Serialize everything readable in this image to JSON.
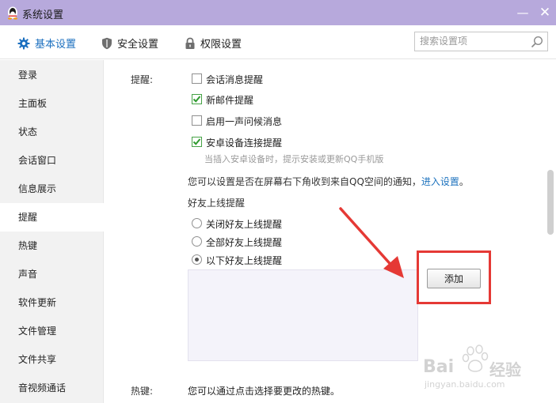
{
  "window": {
    "title": "系统设置",
    "minimize": "—",
    "close": "✕"
  },
  "tabs": [
    {
      "label": "基本设置",
      "icon": "gear-icon",
      "active": true
    },
    {
      "label": "安全设置",
      "icon": "shield-icon",
      "active": false
    },
    {
      "label": "权限设置",
      "icon": "lock-icon",
      "active": false
    }
  ],
  "search": {
    "placeholder": "搜索设置项",
    "value": ""
  },
  "sidebar": {
    "items": [
      {
        "label": "登录"
      },
      {
        "label": "主面板"
      },
      {
        "label": "状态"
      },
      {
        "label": "会话窗口"
      },
      {
        "label": "信息展示"
      },
      {
        "label": "提醒",
        "active": true
      },
      {
        "label": "热键"
      },
      {
        "label": "声音"
      },
      {
        "label": "软件更新"
      },
      {
        "label": "文件管理"
      },
      {
        "label": "文件共享"
      },
      {
        "label": "音视频通话"
      }
    ]
  },
  "reminders": {
    "section_label": "提醒:",
    "options": [
      {
        "label": "会话消息提醒",
        "checked": false
      },
      {
        "label": "新邮件提醒",
        "checked": true
      },
      {
        "label": "启用一声问候消息",
        "checked": false
      },
      {
        "label": "安卓设备连接提醒",
        "checked": true
      }
    ],
    "android_hint": "当插入安卓设备时，提示安装或更新QQ手机版",
    "qzone_notice": "您可以设置是否在屏幕右下角收到来自QQ空间的通知，",
    "qzone_link": "进入设置",
    "qzone_end": "。",
    "friend_online": {
      "label": "好友上线提醒",
      "radios": [
        {
          "label": "关闭好友上线提醒",
          "selected": false
        },
        {
          "label": "全部好友上线提醒",
          "selected": false
        },
        {
          "label": "以下好友上线提醒",
          "selected": true
        }
      ],
      "add_button": "添加"
    }
  },
  "hotkeys": {
    "section_label": "热键:",
    "description": "您可以通过点击选择要更改的热键。"
  },
  "watermark": {
    "brand": "Bai",
    "brand_end": "经验",
    "url": "jingyan.baidu.com"
  },
  "colors": {
    "titlebar": "#b7a9dc",
    "accent": "#1b6fbf",
    "check": "#46a246",
    "annotation": "#e53935"
  }
}
